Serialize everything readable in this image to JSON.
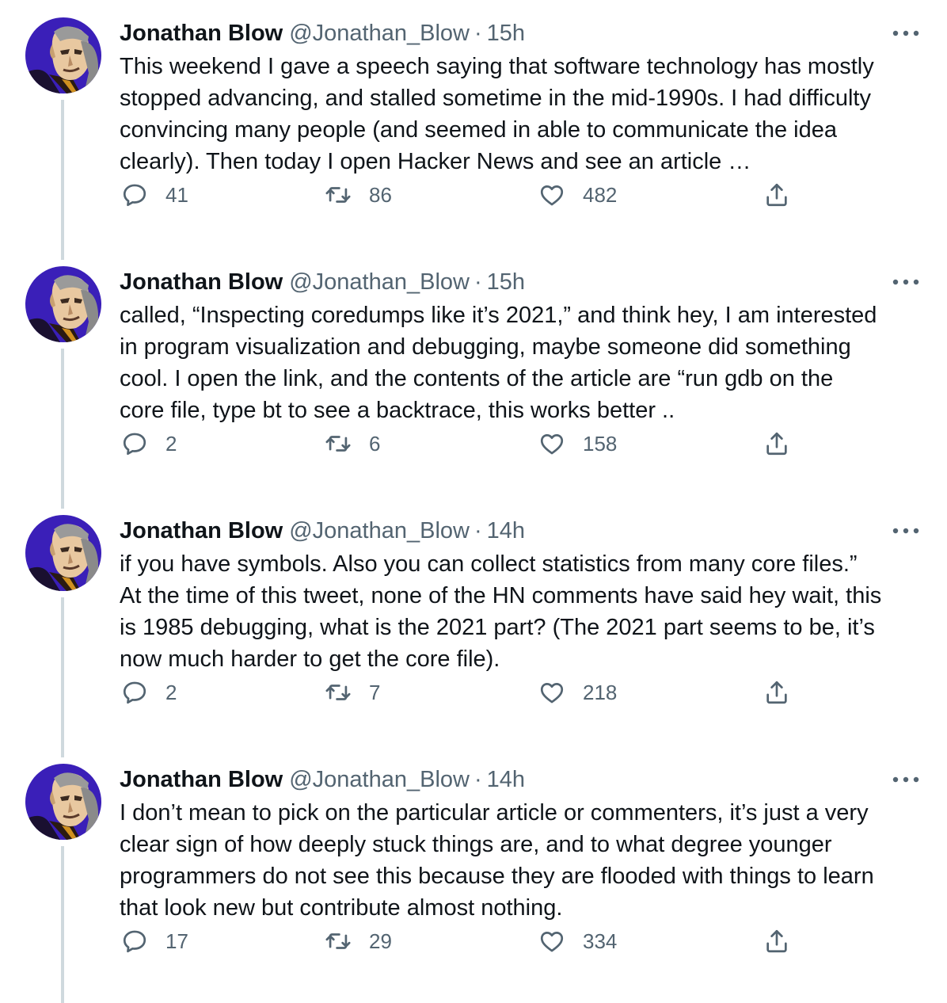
{
  "tweets": [
    {
      "author": "Jonathan Blow",
      "handle": "@Jonathan_Blow",
      "separator": "·",
      "time": "15h",
      "text": "This weekend I gave a speech saying that software technology has mostly\nstopped advancing, and stalled sometime in the mid-1990s. I had difficulty\nconvincing many people (and seemed in able to communicate the idea\nclearly). Then today I open Hacker News and see an article …",
      "replies": "41",
      "retweets": "86",
      "likes": "482"
    },
    {
      "author": "Jonathan Blow",
      "handle": "@Jonathan_Blow",
      "separator": "·",
      "time": "15h",
      "text": "called, “Inspecting coredumps like it’s 2021,” and think hey, I am interested\nin program visualization and debugging, maybe someone did something\ncool. I open the link, and the contents of the article are “run gdb on the\ncore file, type bt to see a backtrace, this works better ..",
      "replies": "2",
      "retweets": "6",
      "likes": "158"
    },
    {
      "author": "Jonathan Blow",
      "handle": "@Jonathan_Blow",
      "separator": "·",
      "time": "14h",
      "text": "if you have symbols. Also you can collect statistics from many core files.”\nAt the time of this tweet, none of the HN comments have said hey wait, this\nis 1985 debugging, what is the 2021 part? (The 2021 part seems to be, it’s\nnow much harder to get the core file).",
      "replies": "2",
      "retweets": "7",
      "likes": "218"
    },
    {
      "author": "Jonathan Blow",
      "handle": "@Jonathan_Blow",
      "separator": "·",
      "time": "14h",
      "text": "I don’t mean to pick on the particular article or commenters, it’s just a very\nclear sign of how deeply stuck things are, and to what degree younger\nprogrammers do not see this because they are flooded with things to learn\nthat look new but contribute almost nothing.",
      "replies": "17",
      "retweets": "29",
      "likes": "334"
    }
  ],
  "colors": {
    "text": "#0f1419",
    "secondary": "#536471",
    "thread_line": "#cfd9de",
    "avatar_background": "#3a1fb8"
  },
  "icons": {
    "more": "more-icon",
    "reply": "reply-icon",
    "retweet": "retweet-icon",
    "like": "like-icon",
    "share": "share-icon"
  }
}
